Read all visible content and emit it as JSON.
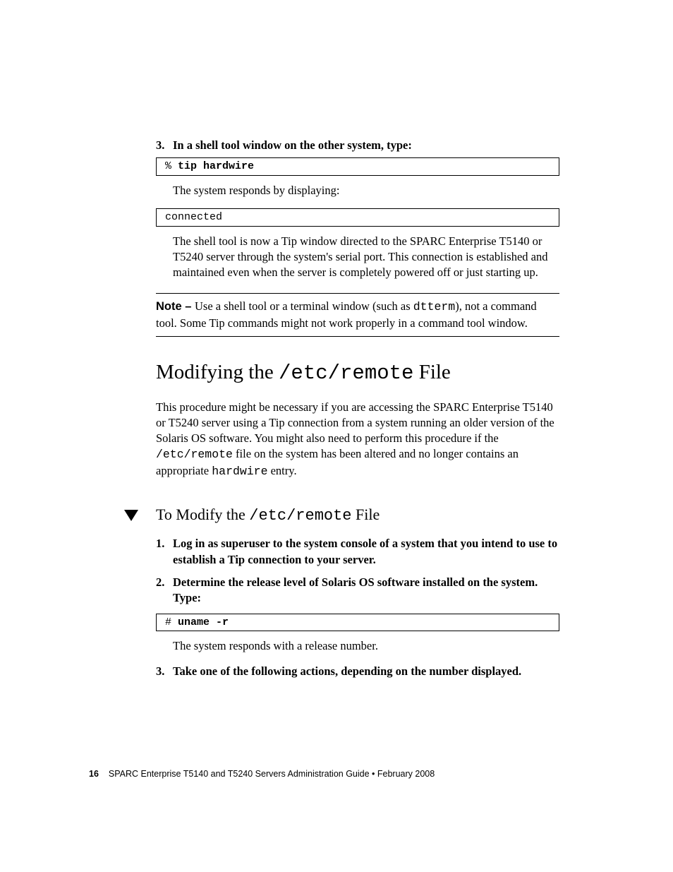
{
  "step3": {
    "num": "3.",
    "text": "In a shell tool window on the other system, type:"
  },
  "code1": {
    "prompt": "% ",
    "cmd": "tip hardwire"
  },
  "resp_intro": "The system responds by displaying:",
  "code2": "connected",
  "tip_explain": "The shell tool is now a Tip window directed to the SPARC Enterprise T5140 or T5240 server through the system's serial port. This connection is established and maintained even when the server is completely powered off or just starting up.",
  "note": {
    "label": "Note – ",
    "pre": "Use a shell tool or a terminal window (such as ",
    "code": "dtterm",
    "post": "), not a command tool. Some Tip commands might not work properly in a command tool window."
  },
  "section": {
    "pre": "Modifying the ",
    "code": "/etc/remote",
    "post": " File"
  },
  "section_para": {
    "p1": "This procedure might be necessary if you are accessing the SPARC Enterprise T5140 or T5240 server using a Tip connection from a system running an older version of the Solaris OS software. You might also need to perform this procedure if the ",
    "c1": "/etc/remote",
    "p2": " file on the system has been altered and no longer contains an appropriate ",
    "c2": "hardwire",
    "p3": " entry."
  },
  "subsection": {
    "pre": "To Modify the ",
    "code": "/etc/remote",
    "post": " File"
  },
  "s1": {
    "num": "1.",
    "text": "Log in as superuser to the system console of a system that you intend to use to establish a Tip connection to your server."
  },
  "s2": {
    "num": "2.",
    "text": "Determine the release level of Solaris OS software installed on the system. Type:"
  },
  "code3": {
    "prompt": "# ",
    "cmd": "uname -r"
  },
  "s2_body": "The system responds with a release number.",
  "s3": {
    "num": "3.",
    "text": "Take one of the following actions, depending on the number displayed."
  },
  "footer": {
    "page": "16",
    "title": "SPARC Enterprise T5140 and T5240 Servers Administration Guide • February 2008"
  }
}
